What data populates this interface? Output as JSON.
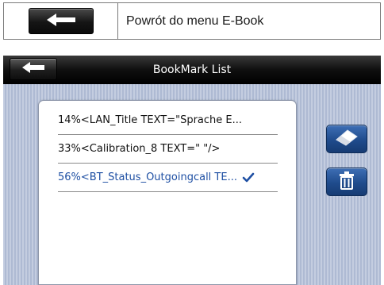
{
  "legend": {
    "description": "Powrót do menu E-Book",
    "icon": "back-arrow-icon"
  },
  "header": {
    "title": "BookMark List",
    "back_icon": "back-arrow-icon"
  },
  "bookmarks": [
    {
      "text": "14%<LAN_Title TEXT=\"Sprache E...",
      "selected": false
    },
    {
      "text": "33%<Calibration_8 TEXT=\" \"/>",
      "selected": false
    },
    {
      "text": "56%<BT_Status_Outgoingcall TE...",
      "selected": true
    }
  ],
  "side_buttons": [
    {
      "icon": "eraser-icon"
    },
    {
      "icon": "trash-icon"
    }
  ],
  "colors": {
    "titlebar": "#000000",
    "button_blue": "#1f4b8c",
    "selected_text": "#1e4fa3",
    "background_stripes": "#aebad3"
  }
}
